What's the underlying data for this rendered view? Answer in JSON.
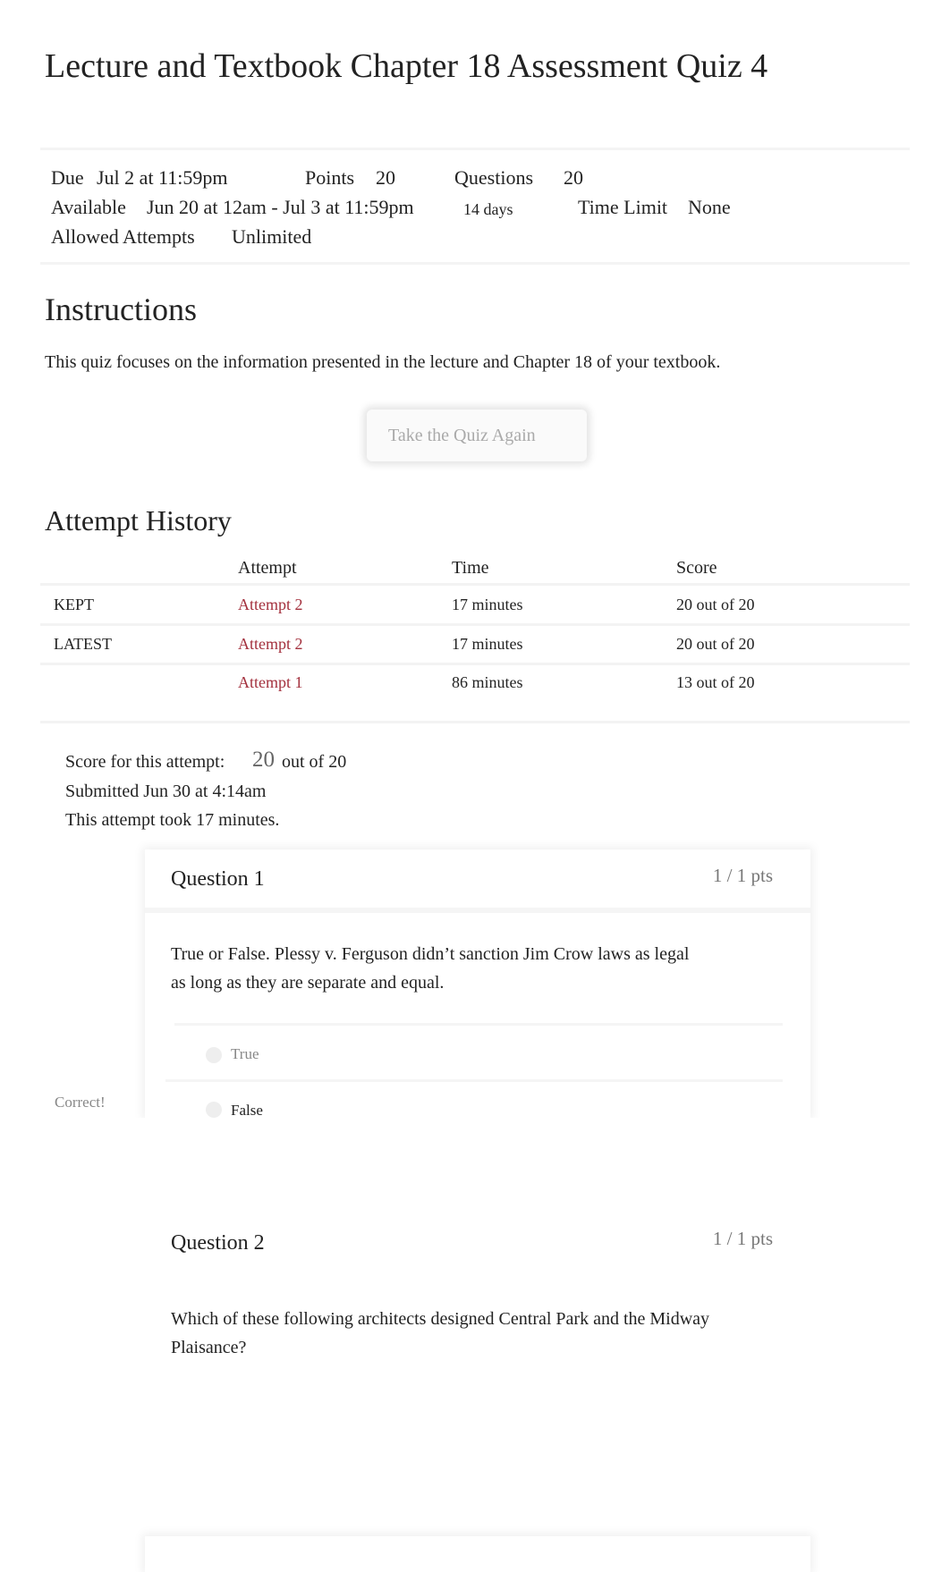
{
  "title": "Lecture and Textbook Chapter 18 Assessment Quiz 4",
  "meta": {
    "due_label": "Due",
    "due": "Jul 2 at 11:59pm",
    "points_label": "Points",
    "points": "20",
    "questions_label": "Questions",
    "questions": "20",
    "available_label": "Available",
    "available": "Jun 20 at 12am - Jul 3 at 11:59pm",
    "available_days": "14 days",
    "time_limit_label": "Time Limit",
    "time_limit": "None",
    "attempts_label": "Allowed Attempts",
    "attempts": "Unlimited"
  },
  "instructions": {
    "heading": "Instructions",
    "text": "This quiz focuses on the information presented in the lecture and Chapter 18 of your textbook.",
    "button": "Take the Quiz Again"
  },
  "history": {
    "heading": "Attempt History",
    "columns": [
      "",
      "Attempt",
      "Time",
      "Score"
    ],
    "rows": [
      {
        "tag": "KEPT",
        "attempt": "Attempt 2",
        "time": "17 minutes",
        "score": "20 out of 20"
      },
      {
        "tag": "LATEST",
        "attempt": "Attempt 2",
        "time": "17 minutes",
        "score": "20 out of 20"
      },
      {
        "tag": "",
        "attempt": "Attempt 1",
        "time": "86 minutes",
        "score": "13 out of 20"
      }
    ]
  },
  "summary": {
    "score_label": "Score for this attempt:",
    "score": "20",
    "score_suffix": "out of 20",
    "submitted": "Submitted Jun 30 at 4:14am",
    "duration": "This attempt took 17 minutes."
  },
  "questions": [
    {
      "title": "Question 1",
      "pts": "1 / 1 pts",
      "text_line1": "True or False. Plessy v. Ferguson didn’t sanction Jim Crow laws as legal",
      "text_line2": "as long as they are separate and equal.",
      "answers": [
        "True",
        "False"
      ],
      "feedback": "Correct!"
    },
    {
      "title": "Question 2",
      "pts": "1 / 1 pts",
      "text_line1": "Which of these following architects designed Central Park and the Midway",
      "text_line2": "Plaisance?"
    }
  ]
}
